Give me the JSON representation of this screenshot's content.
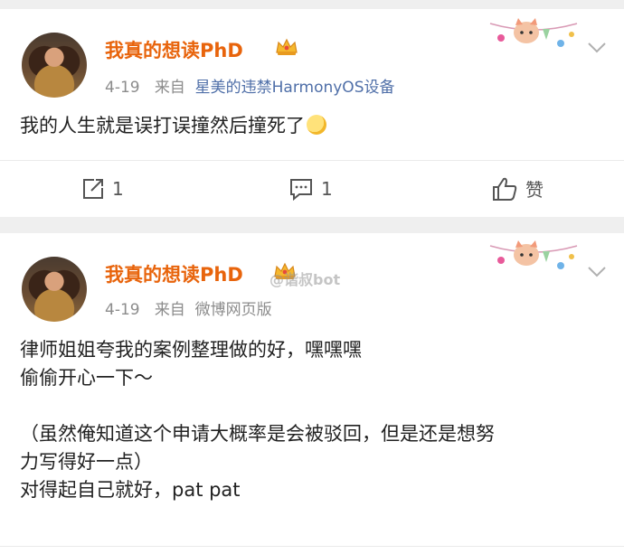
{
  "posts": [
    {
      "username": "我真的想读PhD",
      "date": "4-19",
      "source_prefix": "来自",
      "source": "星美的违禁HarmonyOS设备",
      "lines": [
        "我的人生就是误打误撞然后撞死了"
      ],
      "emoji": "thinking-face-emoji",
      "actions": {
        "repost_count": "1",
        "comment_count": "1",
        "like_label": "赞"
      }
    },
    {
      "username": "我真的想读PhD",
      "date": "4-19",
      "source_prefix": "来自",
      "source": "微博网页版",
      "watermark": "@谐叔bot",
      "lines": [
        "律师姐姐夸我的案例整理做的好，嘿嘿嘿",
        "偷偷开心一下～",
        "",
        "（虽然俺知道这个申请大概率是会被驳回，但是还是想努",
        "力写得好一点）",
        "对得起自己就好，pat pat"
      ]
    }
  ],
  "colors": {
    "username": "#e8640c",
    "source_link": "#4f6fa8",
    "meta": "#8c8c8c",
    "page_bg": "#efefef"
  }
}
